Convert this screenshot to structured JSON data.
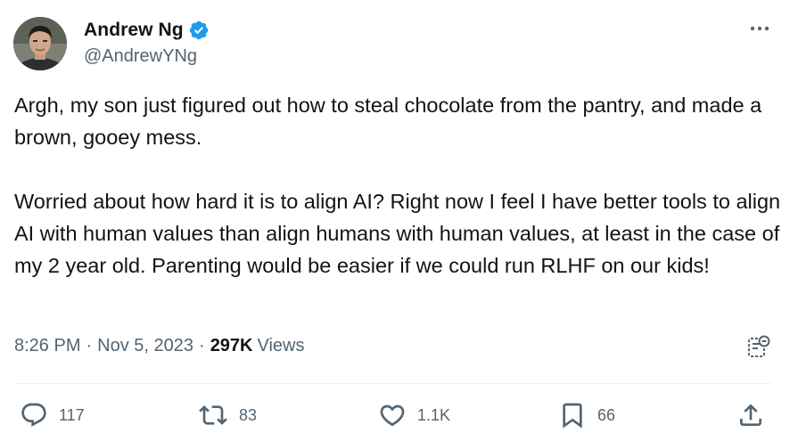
{
  "author": {
    "display_name": "Andrew Ng",
    "handle": "@AndrewYNg",
    "verified": true
  },
  "tweet": {
    "text": "Argh, my son just figured out how to steal chocolate from the pantry, and made a brown, gooey mess.\n\nWorried about how hard it is to align AI? Right now I feel I have better tools to align AI with human values than align humans with human values, at least in the case of my 2 year old. Parenting would be easier if we could run RLHF on our kids!",
    "time": "8:26 PM",
    "date": "Nov 5, 2023",
    "separator": "·",
    "views_count": "297K",
    "views_label": "Views"
  },
  "actions": {
    "replies": "117",
    "reposts": "83",
    "likes": "1.1K",
    "bookmarks": "66"
  },
  "colors": {
    "text": "#0f1419",
    "secondary": "#536471",
    "verified_blue": "#1d9bf0",
    "divider": "#eff3f4"
  },
  "icons": [
    "verified-badge-icon",
    "more-icon",
    "grok-icon",
    "reply-icon",
    "repost-icon",
    "like-icon",
    "bookmark-icon",
    "share-icon"
  ]
}
